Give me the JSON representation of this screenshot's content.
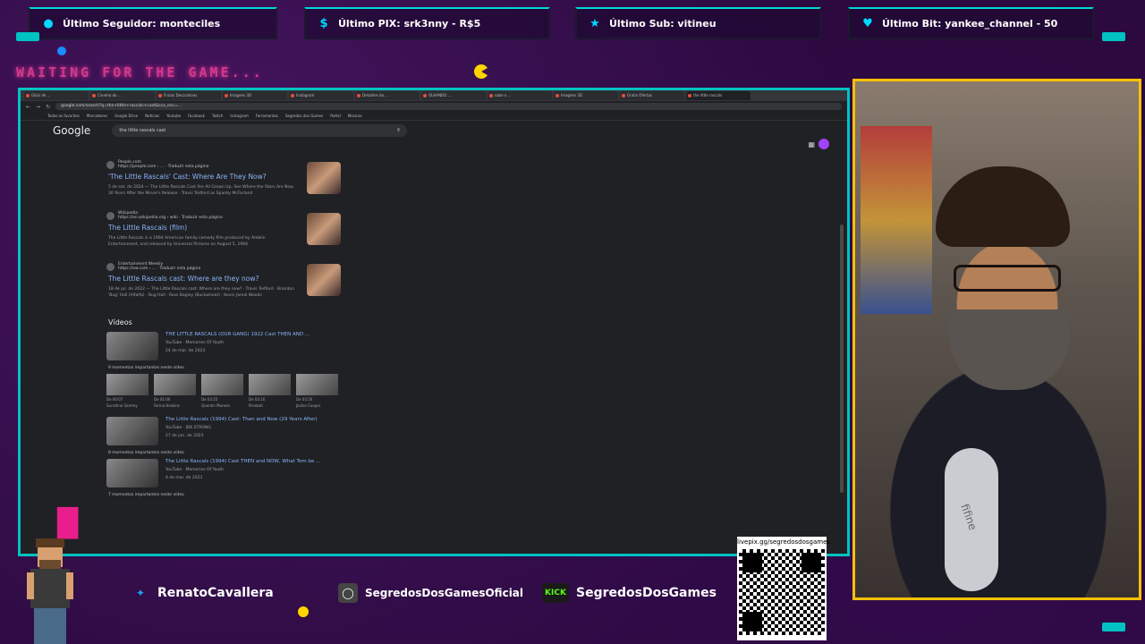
{
  "overlay": {
    "tickers": [
      {
        "icon": "user-icon",
        "label": "Último Seguidor: monteciles"
      },
      {
        "icon": "dollar-icon",
        "label": "Último PIX: srk3nny - R$5"
      },
      {
        "icon": "star-icon",
        "label": "Último Sub: vitineu"
      },
      {
        "icon": "heart-icon",
        "label": "Último Bit: yankee_channel - 50"
      }
    ],
    "waiting_text": "WAITING FOR THE GAME...",
    "colors": {
      "accent": "#00c2c2",
      "pink": "#d03a8a",
      "cam_border": "#ffc107",
      "bg": "#2a0a3d"
    }
  },
  "browser": {
    "tabs": [
      "Gibis de ...",
      "Cinema do ...",
      "Frutas Decorativas",
      "Imagens 3D",
      "Instagram",
      "Detalhes do ...",
      "OLHANDO ...",
      "sabe o ...",
      "Imagens 3D",
      "Gratis Ofertas",
      "the little rascals"
    ],
    "url": "google.com/search?q=the+little+rascals+cast&sca_esv=...",
    "bookmarks": [
      "Todos os favoritos",
      "Marcadores",
      "Google Drive",
      "Notícias",
      "Youtube",
      "Facebook",
      "Twitch",
      "Instagram",
      "Ferramentas",
      "Segredos dos Games",
      "Portal",
      "Músicas"
    ],
    "search_query": "the little rascals cast",
    "google_logo": "Google",
    "results": [
      {
        "site": "People.com",
        "url": "https://people.com › ... · Traduzir esta página",
        "title": "'The Little Rascals' Cast: Where Are They Now?",
        "snippet": "5 de set. de 2024 — The Little Rascals Cast Are All Grown Up. See Where the Stars Are Now. 30 Years After the Movie's Release · Travis Tedford as Spanky McFarland"
      },
      {
        "site": "Wikipedia",
        "url": "https://en.wikipedia.org › wiki · Traduzir esta página",
        "title": "The Little Rascals (film)",
        "snippet": "The Little Rascals is a 1994 American family comedy film produced by Amblin Entertainment, and released by Universal Pictures on August 5, 1994."
      },
      {
        "site": "Entertainment Weekly",
        "url": "https://ew.com › ... · Traduzir esta página",
        "title": "The Little Rascals cast: Where are they now?",
        "snippet": "18 de jul. de 2022 — The Little Rascals cast: Where are they now? · Travis Tedford · Brandon 'Bug' Hall (Alfalfa) · Bug Hall · Ross Bagley (Buckwheat) · Kevin Jamal Woods"
      }
    ],
    "videos_heading": "Vídeos",
    "videos": [
      {
        "title": "THE LITTLE RASCALS (OUR GANG) 1922 Cast THEN AND ...",
        "channel": "YouTube · Memories Of Youth",
        "date": "24 de mar. de 2023"
      },
      {
        "title": "The Little Rascals (1994) Cast: Then and Now (29 Years After)",
        "channel": "YouTube · IDK STRONG",
        "date": "27 de jun. de 2023"
      },
      {
        "title": "The Little Rascals (1994) Cast THEN and NOW, What Tom be ...",
        "channel": "YouTube · Memories Of Youth",
        "date": "4 de mar. de 2023"
      }
    ],
    "moments_label_1": "9 momentos importantes neste vídeo",
    "moments": [
      {
        "time": "De 00:07",
        "name": "Sunshine Sammy"
      },
      {
        "time": "De 01:00",
        "name": "Farina Hoskins"
      },
      {
        "time": "De 03:25",
        "name": "Quentin Maroon"
      },
      {
        "time": "De 03:16",
        "name": "Pineball"
      },
      {
        "time": "De 03:50",
        "name": "Jackie Cooper"
      }
    ],
    "moments_label_2": "8 momentos importantes neste vídeo",
    "moments_label_3": "7 momentos importantes neste vídeo"
  },
  "webcam": {
    "mic_brand": "fifine"
  },
  "footer": {
    "socials": [
      {
        "icon": "twitter-icon",
        "name": "RenatoCavallera"
      },
      {
        "icon": "instagram-icon",
        "name": "SegredosDosGamesOficial"
      },
      {
        "icon": "kick-icon",
        "label": "KICK",
        "name": "SegredosDosGames"
      }
    ],
    "qr_url": "livepix.gg/segredosdosgames"
  }
}
